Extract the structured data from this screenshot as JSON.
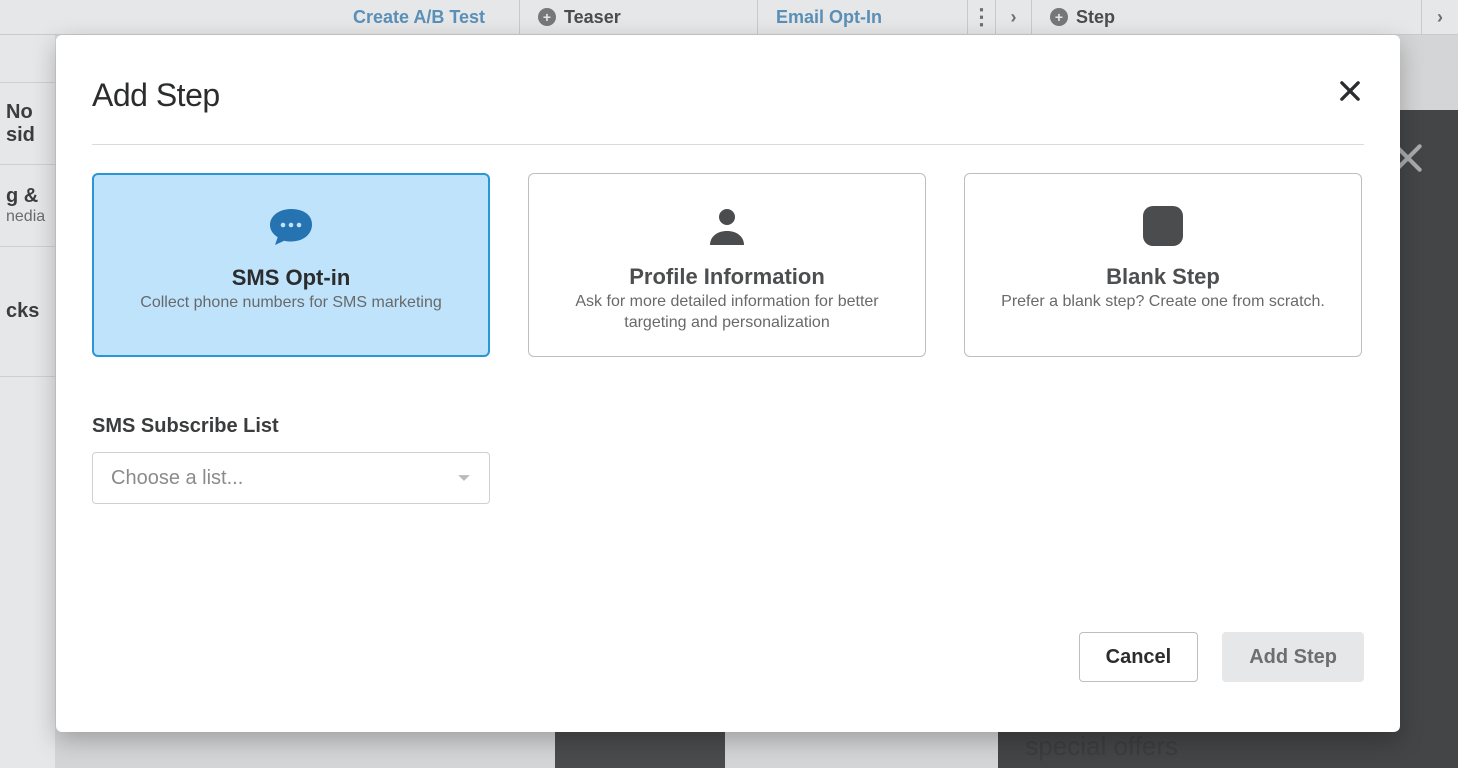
{
  "backdrop": {
    "ab_test": "Create A/B Test",
    "teaser": "Teaser",
    "email_optin": "Email Opt-In",
    "step": "Step",
    "no_side": "No sid",
    "g_amp": "g &",
    "media": "nedia",
    "cks": "cks",
    "special_offers": "special offers"
  },
  "modal": {
    "title": "Add Step",
    "cards": [
      {
        "title": "SMS Opt-in",
        "desc": "Collect phone numbers for SMS marketing"
      },
      {
        "title": "Profile Information",
        "desc": "Ask for more detailed information for better targeting and personalization"
      },
      {
        "title": "Blank Step",
        "desc": "Prefer a blank step? Create one from scratch."
      }
    ],
    "field_label": "SMS Subscribe List",
    "select_placeholder": "Choose a list...",
    "cancel": "Cancel",
    "add": "Add Step"
  }
}
